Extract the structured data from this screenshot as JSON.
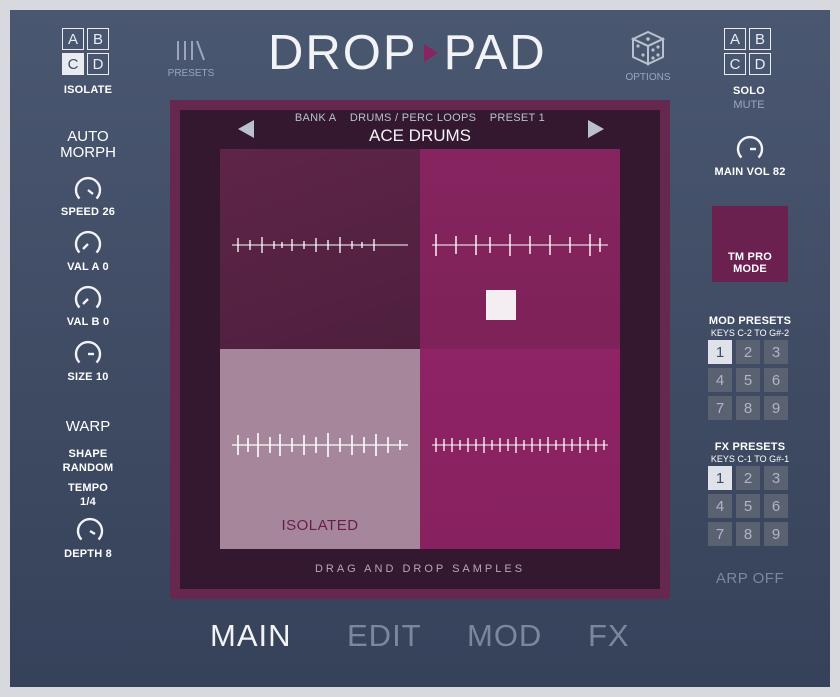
{
  "app": {
    "title_left": "DROP",
    "title_right": "PAD"
  },
  "isolate": {
    "cells": [
      "A",
      "B",
      "C",
      "D"
    ],
    "active": "C",
    "label": "ISOLATE"
  },
  "solo": {
    "cells": [
      "A",
      "B",
      "C",
      "D"
    ],
    "label": "SOLO",
    "sublabel": "MUTE"
  },
  "presets_btn": {
    "label": "PRESETS"
  },
  "options_btn": {
    "label": "OPTIONS"
  },
  "auto_morph": {
    "title_line1": "AUTO",
    "title_line2": "MORPH",
    "speed": "SPEED 26",
    "val_a": "VAL A 0",
    "val_b": "VAL B 0",
    "size": "SIZE 10"
  },
  "warp": {
    "title": "WARP",
    "shape_line1": "SHAPE",
    "shape_line2": "RANDOM",
    "tempo_line1": "TEMPO",
    "tempo_line2": "1/4",
    "depth": "DEPTH 8"
  },
  "main_vol": {
    "label": "MAIN VOL 82"
  },
  "tm_pro": {
    "line1": "TM PRO",
    "line2": "MODE"
  },
  "browser": {
    "bank": "BANK A",
    "category": "DRUMS / PERC LOOPS",
    "preset": "PRESET 1",
    "name": "ACE DRUMS"
  },
  "pads": {
    "isolated_label": "ISOLATED",
    "drop_hint": "DRAG AND DROP SAMPLES"
  },
  "mod_presets": {
    "title": "MOD PRESETS",
    "keys": "KEYS C-2 TO G#-2",
    "buttons": [
      "1",
      "2",
      "3",
      "4",
      "5",
      "6",
      "7",
      "8",
      "9"
    ],
    "active": "1"
  },
  "fx_presets": {
    "title": "FX PRESETS",
    "keys": "KEYS C-1 TO G#-1",
    "buttons": [
      "1",
      "2",
      "3",
      "4",
      "5",
      "6",
      "7",
      "8",
      "9"
    ],
    "active": "1"
  },
  "arp": {
    "label": "ARP OFF"
  },
  "tabs": {
    "main": "MAIN",
    "edit": "EDIT",
    "mod": "MOD",
    "fx": "FX",
    "active": "MAIN"
  },
  "colors": {
    "accent": "#8a2460",
    "pad_tl": "#5a2244",
    "pad_tr": "#84235f",
    "pad_bl": "#a6859a",
    "pad_br": "#8c2263",
    "background": "#3f4b63"
  }
}
